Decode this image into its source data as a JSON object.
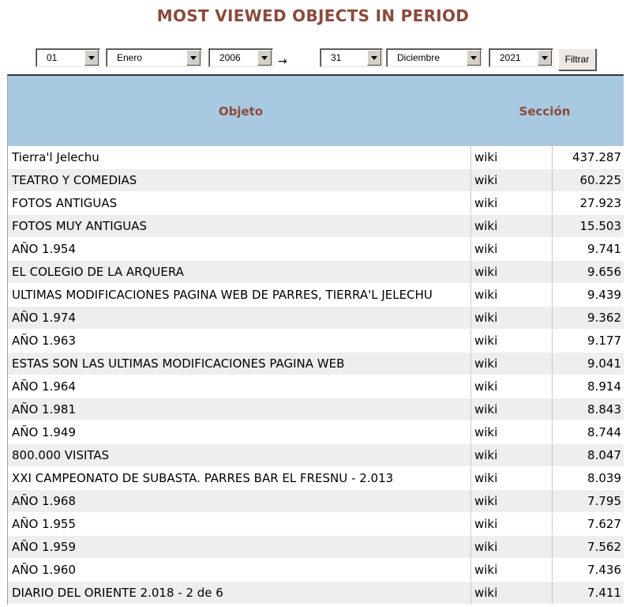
{
  "page": {
    "title": "MOST VIEWED OBJECTS IN PERIOD"
  },
  "filter": {
    "from_day": "01",
    "from_month": "Enero",
    "from_year": "2006",
    "range_arrow": "→",
    "to_day": "31",
    "to_month": "Diciembre",
    "to_year": "2021",
    "button_label": "Filtrar"
  },
  "table": {
    "headers": {
      "objeto": "Objeto",
      "seccion": "Sección"
    },
    "rows": [
      {
        "objeto": "Tierra'l Jelechu",
        "seccion": "wiki",
        "visitas": "437.287"
      },
      {
        "objeto": "TEATRO Y COMEDIAS",
        "seccion": "wiki",
        "visitas": "60.225"
      },
      {
        "objeto": "FOTOS ANTIGUAS",
        "seccion": "wiki",
        "visitas": "27.923"
      },
      {
        "objeto": "FOTOS MUY ANTIGUAS",
        "seccion": "wiki",
        "visitas": "15.503"
      },
      {
        "objeto": "AÑO 1.954",
        "seccion": "wiki",
        "visitas": "9.741"
      },
      {
        "objeto": "EL COLEGIO DE LA ARQUERA",
        "seccion": "wiki",
        "visitas": "9.656"
      },
      {
        "objeto": "ULTIMAS MODIFICACIONES PAGINA WEB DE PARRES, TIERRA'L JELECHU",
        "seccion": "wiki",
        "visitas": "9.439"
      },
      {
        "objeto": "AÑO 1.974",
        "seccion": "wiki",
        "visitas": "9.362"
      },
      {
        "objeto": "AÑO 1.963",
        "seccion": "wiki",
        "visitas": "9.177"
      },
      {
        "objeto": "ESTAS SON LAS ULTIMAS MODIFICACIONES PAGINA WEB",
        "seccion": "wiki",
        "visitas": "9.041"
      },
      {
        "objeto": "AÑO 1.964",
        "seccion": "wiki",
        "visitas": "8.914"
      },
      {
        "objeto": "AÑO 1.981",
        "seccion": "wiki",
        "visitas": "8.843"
      },
      {
        "objeto": "AÑO 1.949",
        "seccion": "wiki",
        "visitas": "8.744"
      },
      {
        "objeto": "800.000 VISITAS",
        "seccion": "wiki",
        "visitas": "8.047"
      },
      {
        "objeto": "XXI CAMPEONATO DE SUBASTA. PARRES BAR EL FRESNU - 2.013",
        "seccion": "wiki",
        "visitas": "8.039"
      },
      {
        "objeto": "AÑO 1.968",
        "seccion": "wiki",
        "visitas": "7.795"
      },
      {
        "objeto": "AÑO 1.955",
        "seccion": "wiki",
        "visitas": "7.627"
      },
      {
        "objeto": "AÑO 1.959",
        "seccion": "wiki",
        "visitas": "7.562"
      },
      {
        "objeto": "AÑO 1.960",
        "seccion": "wiki",
        "visitas": "7.436"
      },
      {
        "objeto": "DIARIO DEL ORIENTE 2.018 - 2 de 6",
        "seccion": "wiki",
        "visitas": "7.411"
      }
    ]
  },
  "colors": {
    "title": "#8b4a3c",
    "header_bg": "#a9c9e1",
    "row_alt_bg": "#eeeeee"
  }
}
